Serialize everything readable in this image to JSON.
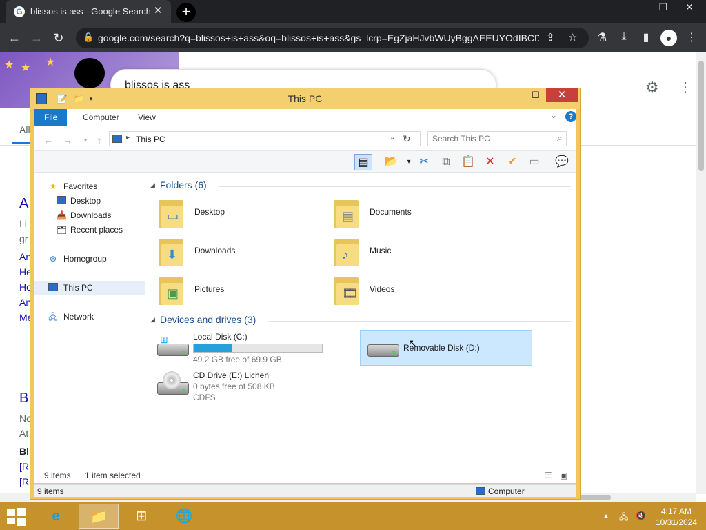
{
  "browser": {
    "tab_title": "blissos is ass - Google Search",
    "url": "google.com/search?q=blissos+is+ass&oq=blissos+is+ass&gs_lcrp=EgZjaHJvbWUyBggAEEUYOdIBCD...",
    "colors": {
      "frame": "#202124",
      "toolbar": "#35363a"
    }
  },
  "google": {
    "query": "blissos is ass",
    "tab_all": "All",
    "results_fragments": [
      "A",
      "I i",
      "gr",
      "An",
      "He",
      "Ho",
      "An",
      "Me",
      "B",
      "No",
      "At",
      "Bl",
      "[R",
      "[R"
    ]
  },
  "explorer": {
    "title": "This PC",
    "ribbon_tabs": [
      "File",
      "Computer",
      "View"
    ],
    "breadcrumb": "This PC",
    "search_placeholder": "Search This PC",
    "nav": {
      "favorites": "Favorites",
      "desktop": "Desktop",
      "downloads": "Downloads",
      "recent": "Recent places",
      "homegroup": "Homegroup",
      "this_pc": "This PC",
      "network": "Network"
    },
    "folders_header": "Folders (6)",
    "folders": [
      "Desktop",
      "Documents",
      "Downloads",
      "Music",
      "Pictures",
      "Videos"
    ],
    "drives_header": "Devices and drives (3)",
    "drives": {
      "c_name": "Local Disk (C:)",
      "c_free": "49.2 GB free of 69.9 GB",
      "c_used_fraction": 0.296,
      "d_name": "Removable Disk (D:)",
      "e_name": "CD Drive (E:) Lichen",
      "e_free": "0 bytes free of 508 KB",
      "e_fs": "CDFS"
    },
    "status_items": "9 items",
    "status_selected": "1 item selected",
    "details_items": "9 items",
    "details_location": "Computer",
    "accent": "#1979ca",
    "frame_color": "#f0c85a"
  },
  "taskbar": {
    "time": "4:17 AM",
    "date": "10/31/2024",
    "color": "#c6922c"
  }
}
